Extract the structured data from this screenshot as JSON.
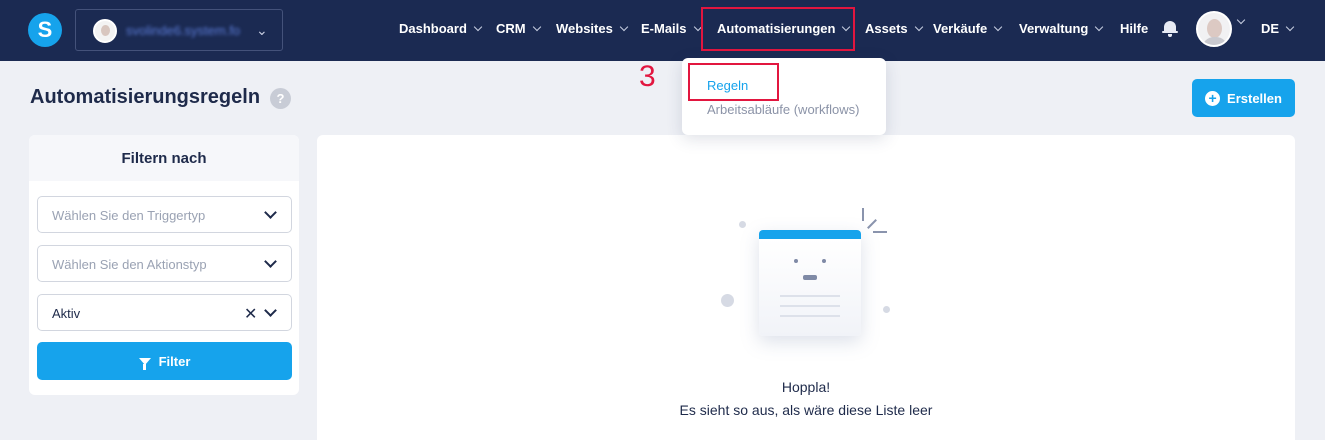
{
  "nav": {
    "account_name": "svolinde6.system.fo",
    "items": [
      {
        "label": "Dashboard"
      },
      {
        "label": "CRM"
      },
      {
        "label": "Websites"
      },
      {
        "label": "E-Mails"
      },
      {
        "label": "Automatisierungen"
      },
      {
        "label": "Assets"
      },
      {
        "label": "Verkäufe"
      },
      {
        "label": "Verwaltung"
      },
      {
        "label": "Hilfe"
      }
    ],
    "language": "DE",
    "logo_letter": "S"
  },
  "dropdown": {
    "items": [
      {
        "label": "Regeln"
      },
      {
        "label": "Arbeitsabläufe (workflows)"
      }
    ]
  },
  "annotation": {
    "step_number": "3"
  },
  "page": {
    "title": "Automatisierungsregeln",
    "help_glyph": "?",
    "create_button": "Erstellen"
  },
  "filter": {
    "heading": "Filtern nach",
    "trigger_placeholder": "Wählen Sie den Triggertyp",
    "action_placeholder": "Wählen Sie den Aktionstyp",
    "status_value": "Aktiv",
    "filter_button": "Filter"
  },
  "empty_state": {
    "title": "Hoppla!",
    "message": "Es sieht so aus, als wäre diese Liste leer"
  },
  "colors": {
    "nav_bg": "#1b2a52",
    "accent": "#16a3ec",
    "highlight": "#e2163f",
    "page_bg": "#eef0f5"
  }
}
